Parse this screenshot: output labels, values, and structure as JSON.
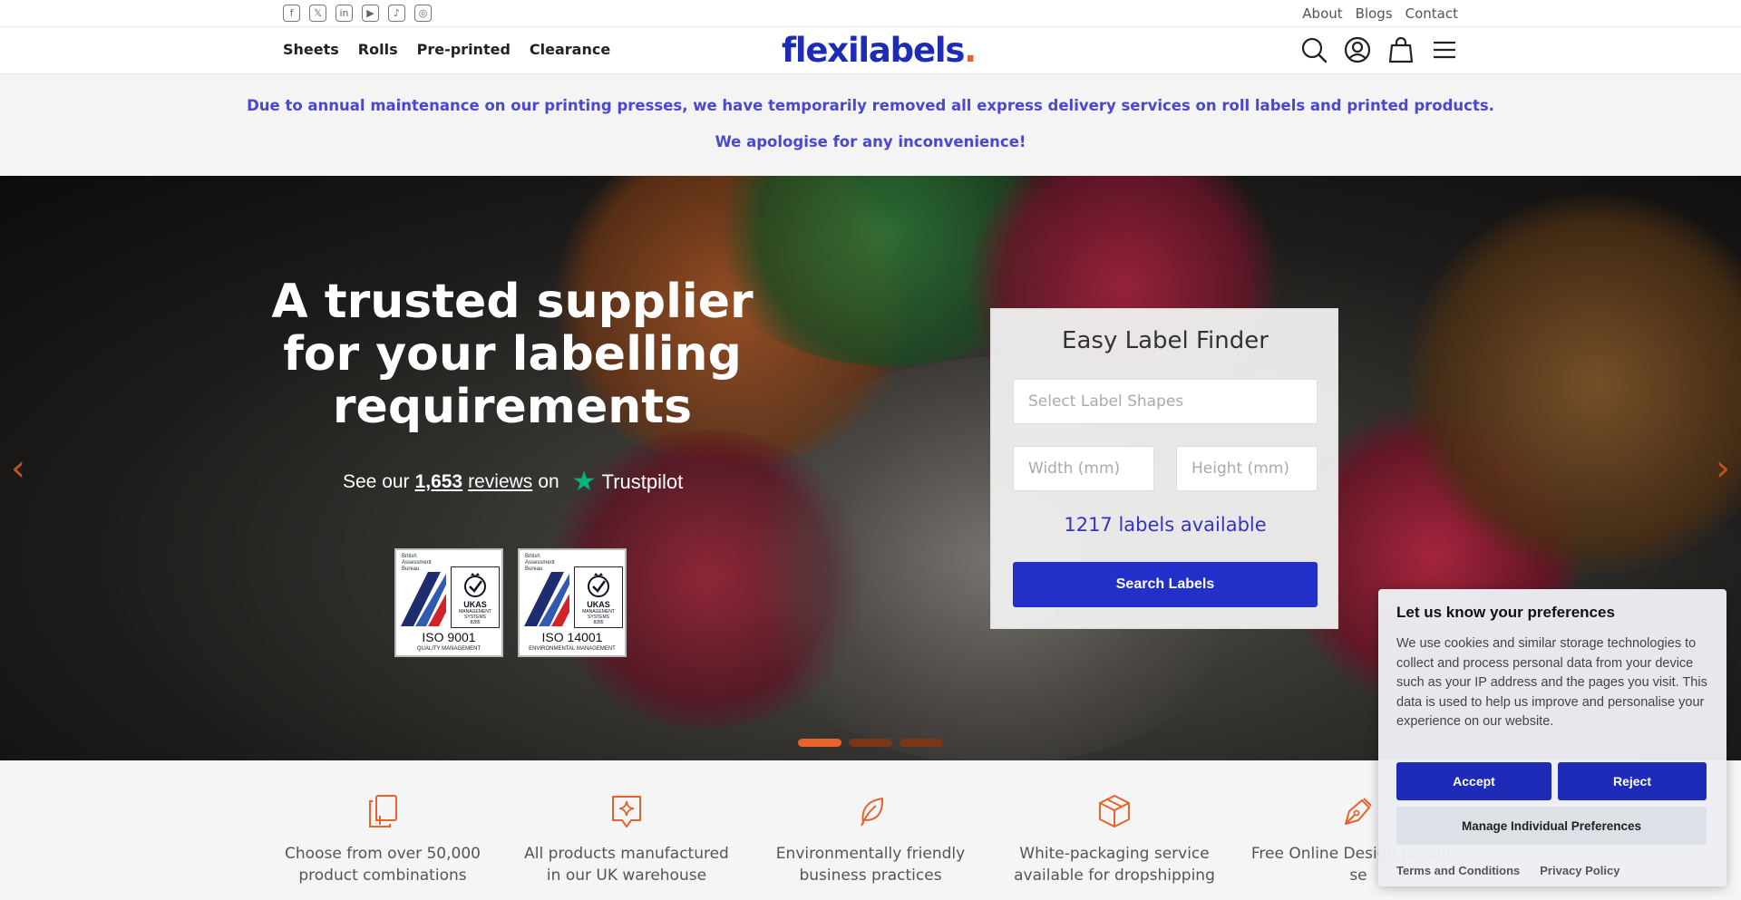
{
  "topbar": {
    "social": [
      {
        "name": "facebook",
        "glyph": "f"
      },
      {
        "name": "x",
        "glyph": "𝕏"
      },
      {
        "name": "linkedin",
        "glyph": "in"
      },
      {
        "name": "youtube",
        "glyph": "▶"
      },
      {
        "name": "tiktok",
        "glyph": "♪"
      },
      {
        "name": "instagram",
        "glyph": "◎"
      }
    ],
    "links": [
      "About",
      "Blogs",
      "Contact"
    ]
  },
  "nav": {
    "items": [
      "Sheets",
      "Rolls",
      "Pre-printed",
      "Clearance"
    ],
    "logo_text": "flexilabels",
    "logo_dot": ".",
    "icons": [
      "search-icon",
      "account-icon",
      "cart-icon",
      "menu-icon"
    ]
  },
  "notice": {
    "line1": "Due to annual maintenance on our printing presses, we have temporarily removed all express delivery services on roll labels and printed products.",
    "line2": "We apologise for any inconvenience!"
  },
  "hero": {
    "title": "A trusted supplier for your labelling requirements",
    "trust_prefix": "See our",
    "trust_count": "1,653",
    "trust_reviews": "reviews",
    "trust_on": "on",
    "trust_brand": "Trustpilot",
    "badges": [
      {
        "bureau": "British Assessment Bureau",
        "ukas": "UKAS",
        "ukas_sub": "MANAGEMENT SYSTEMS",
        "code": "8285",
        "iso": "ISO 9001",
        "sub": "QUALITY MANAGEMENT"
      },
      {
        "bureau": "British Assessment Bureau",
        "ukas": "UKAS",
        "ukas_sub": "MANAGEMENT SYSTEMS",
        "code": "8285",
        "iso": "ISO 14001",
        "sub": "ENVIRONMENTAL MANAGEMENT"
      }
    ],
    "slides_total": 3,
    "active_slide": 1
  },
  "finder": {
    "title": "Easy Label Finder",
    "shape_placeholder": "Select Label Shapes",
    "width_placeholder": "Width (mm)",
    "height_placeholder": "Height (mm)",
    "available": "1217 labels available",
    "button": "Search Labels"
  },
  "features": [
    {
      "icon": "files-plus-icon",
      "text": "Choose from over 50,000 product combinations"
    },
    {
      "icon": "sparkle-tag-icon",
      "text": "All products manufactured in our UK warehouse"
    },
    {
      "icon": "leaf-icon",
      "text": "Environmentally friendly business practices"
    },
    {
      "icon": "box-icon",
      "text": "White-packaging service available for dropshipping"
    },
    {
      "icon": "pen-nib-icon",
      "text": "Free Online Design proofing se"
    }
  ],
  "cookie": {
    "title": "Let us know your preferences",
    "body": "We use cookies and similar storage technologies to collect and process personal data from your device such as your IP address and the pages you visit. This data is used to help us improve and personalise your experience on our website.",
    "accept": "Accept",
    "reject": "Reject",
    "manage": "Manage Individual Preferences",
    "terms": "Terms and Conditions",
    "privacy": "Privacy Policy"
  },
  "colors": {
    "brand_blue": "#1e2bb4",
    "accent_orange": "#e8622b",
    "notice_text": "#4a47d1",
    "trustpilot_green": "#00b67a"
  }
}
